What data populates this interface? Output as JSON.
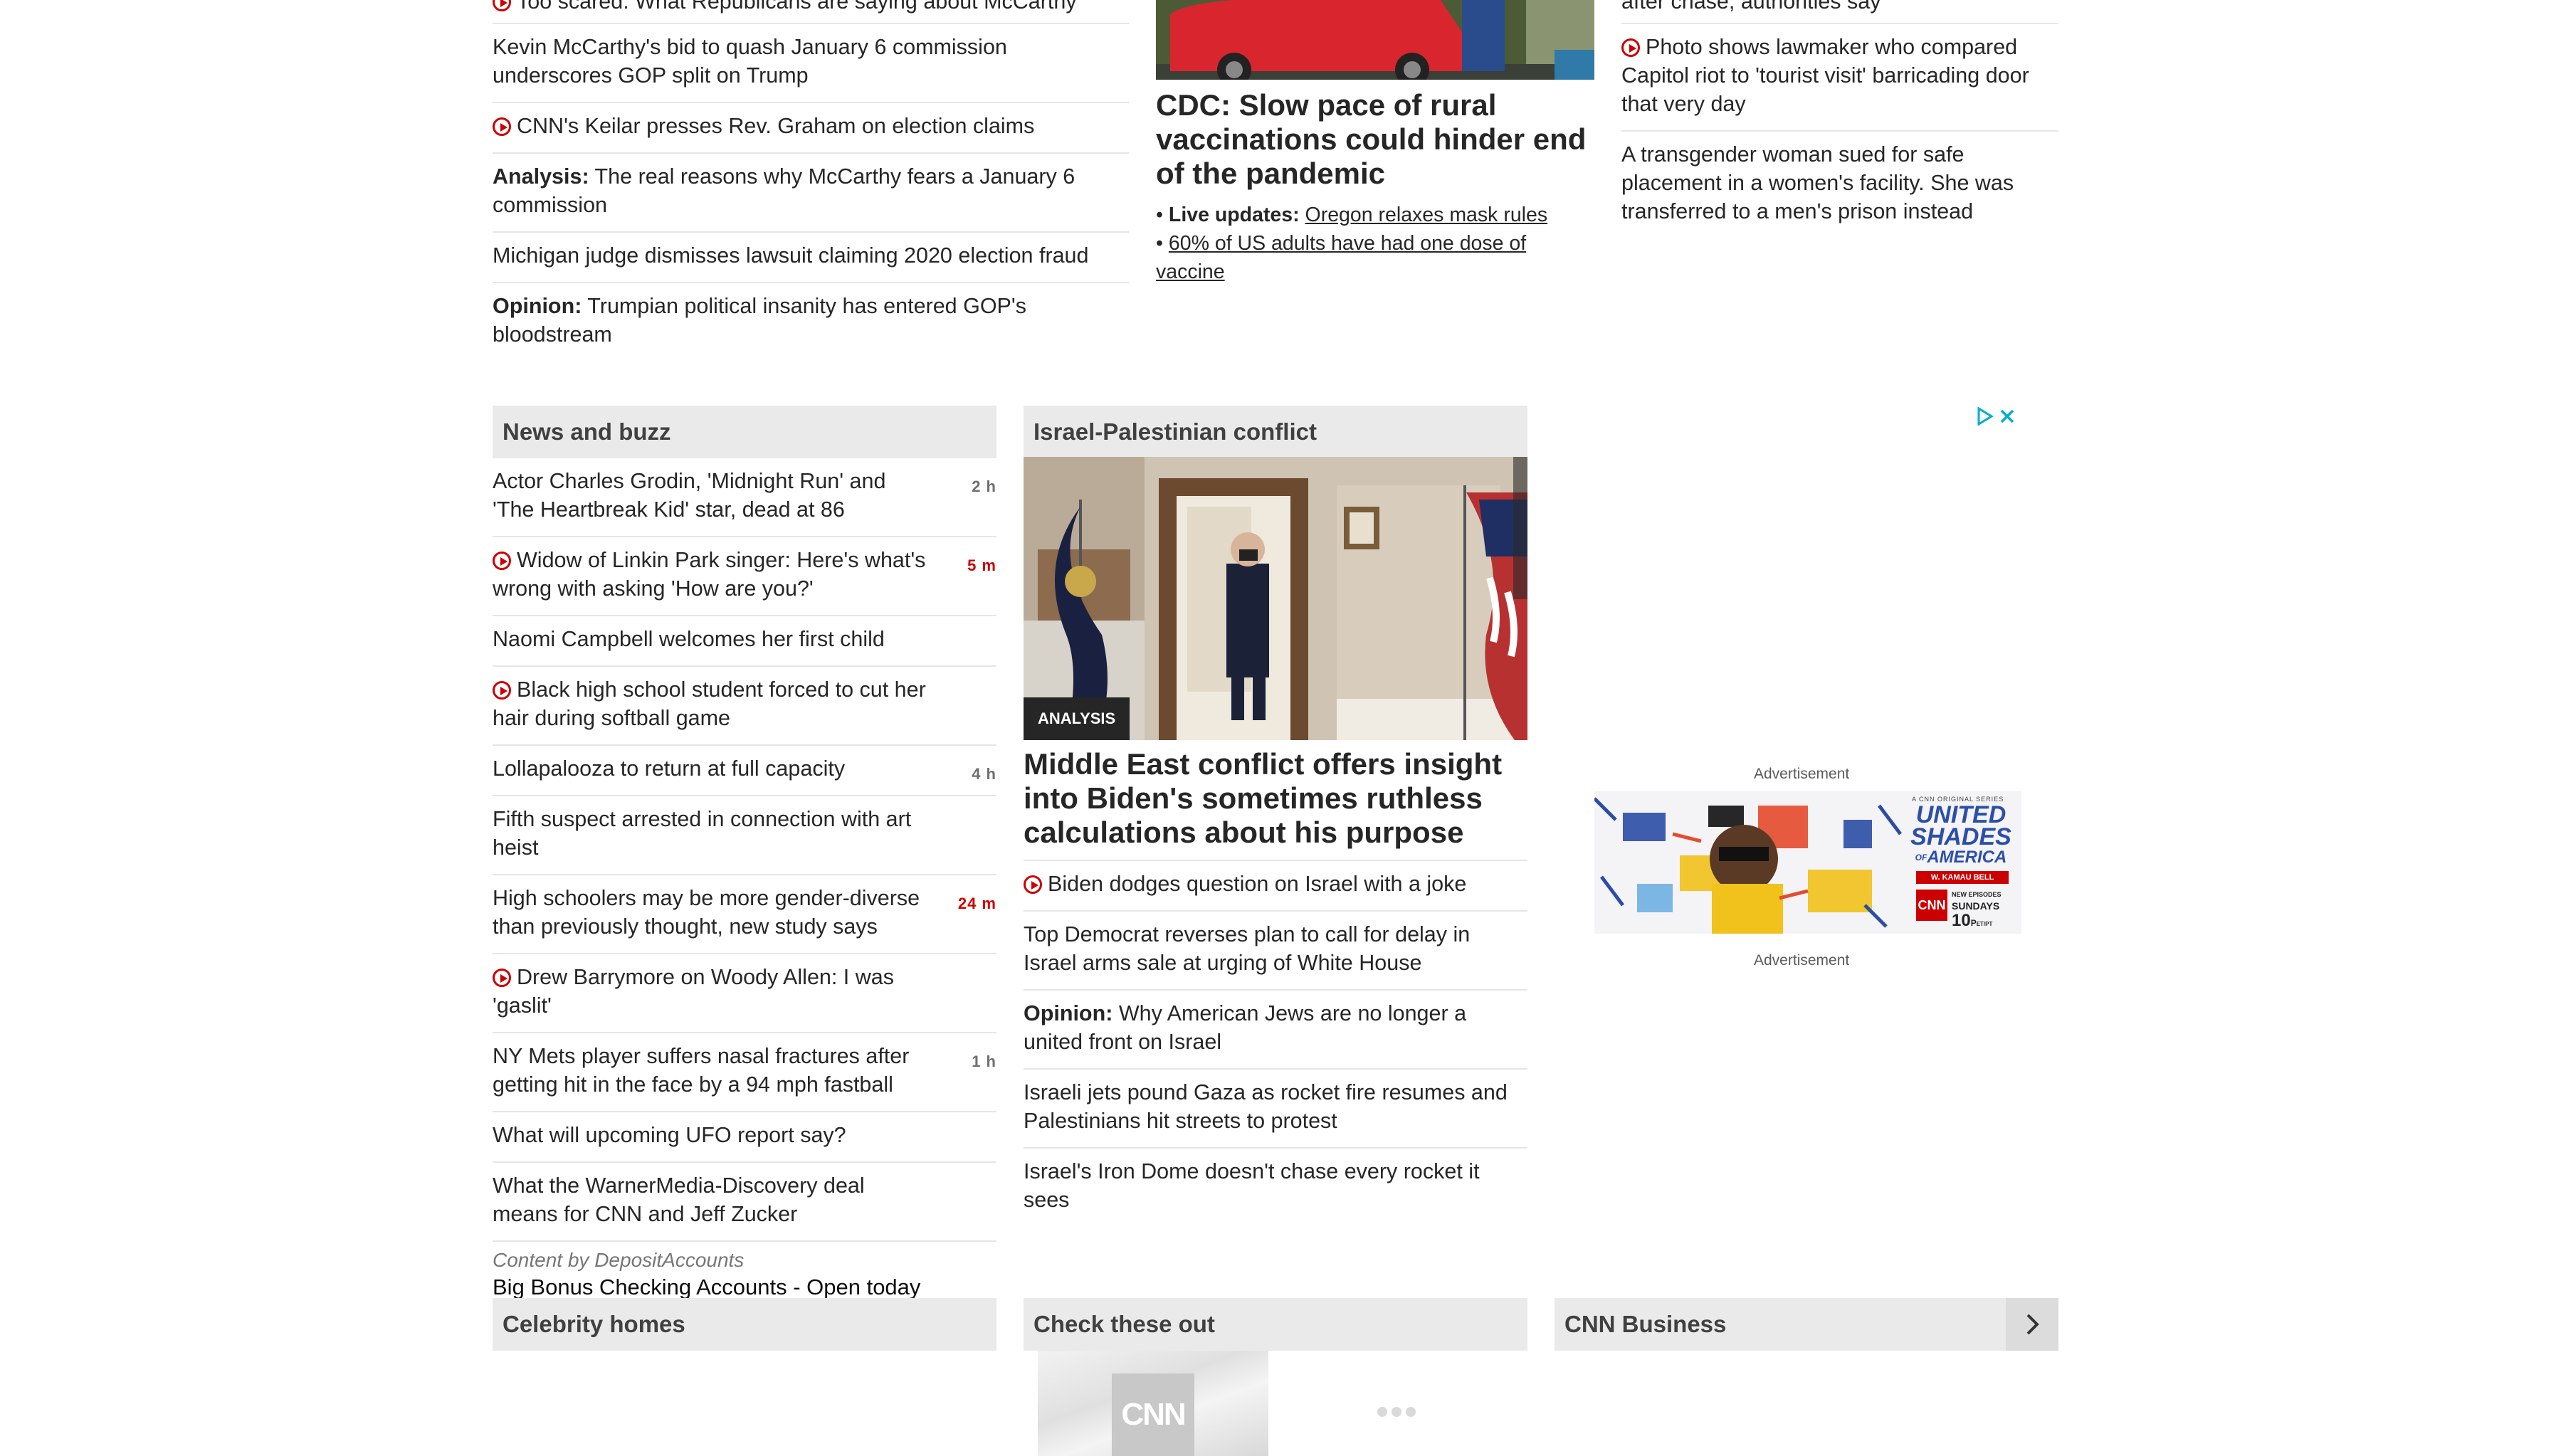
{
  "top_left": {
    "cut_item": "Too scared: What Republicans are saying about McCarthy",
    "items": [
      {
        "prefix": "",
        "text": "Kevin McCarthy's bid to quash January 6 commission underscores GOP split on Trump",
        "video": false
      },
      {
        "prefix": "",
        "text": "CNN's Keilar presses Rev. Graham on election claims",
        "video": true
      },
      {
        "prefix": "Analysis:",
        "text": " The real reasons why McCarthy fears a January 6 commission",
        "video": false
      },
      {
        "prefix": "",
        "text": "Michigan judge dismisses lawsuit claiming 2020 election fraud",
        "video": false
      },
      {
        "prefix": "Opinion:",
        "text": " Trumpian political insanity has entered GOP's bloodstream",
        "video": false
      }
    ]
  },
  "top_middle": {
    "headline": "CDC: Slow pace of rural vaccinations could hinder end of the pandemic",
    "bullet1_prefix": "Live updates:",
    "bullet1_text": "Oregon relaxes mask rules",
    "bullet2_text": "60% of US adults have had one dose of vaccine"
  },
  "top_right": {
    "cut_item": "after chase, authorities say",
    "items": [
      {
        "text": "Photo shows lawmaker who compared Capitol riot to 'tourist visit' barricading door that very day",
        "video": true
      },
      {
        "text": "A transgender woman sued for safe placement in a women's facility. She was transferred to a men's prison instead",
        "video": false
      }
    ]
  },
  "news_buzz": {
    "title": "News and buzz",
    "items": [
      {
        "text": "Actor Charles Grodin, 'Midnight Run' and 'The Heartbreak Kid' star, dead at 86",
        "time": "2 h",
        "red": false,
        "video": false
      },
      {
        "text": "Widow of Linkin Park singer: Here's what's wrong with asking 'How are you?'",
        "time": "5 m",
        "red": true,
        "video": true
      },
      {
        "text": "Naomi Campbell welcomes her first child",
        "time": "",
        "red": false,
        "video": false
      },
      {
        "text": "Black high school student forced to cut her hair during softball game",
        "time": "",
        "red": false,
        "video": true
      },
      {
        "text": "Lollapalooza to return at full capacity",
        "time": "4 h",
        "red": false,
        "video": false
      },
      {
        "text": "Fifth suspect arrested in connection with art heist",
        "time": "",
        "red": false,
        "video": false
      },
      {
        "text": "High schoolers may be more gender-diverse than previously thought, new study says",
        "time": "24 m",
        "red": true,
        "video": false
      },
      {
        "text": "Drew Barrymore on Woody Allen: I was 'gaslit'",
        "time": "",
        "red": false,
        "video": true
      },
      {
        "text": "NY Mets player suffers nasal fractures after getting hit in the face by a 94 mph fastball",
        "time": "1 h",
        "red": false,
        "video": false
      },
      {
        "text": "What will upcoming UFO report say?",
        "time": "",
        "red": false,
        "video": false
      },
      {
        "text": "What the WarnerMedia-Discovery deal means for CNN and Jeff Zucker",
        "time": "",
        "red": false,
        "video": false
      }
    ],
    "sponsor_label": "Content by DepositAccounts",
    "sponsor_link": "Big Bonus Checking Accounts - Open today"
  },
  "israel": {
    "title": "Israel-Palestinian conflict",
    "tag": "ANALYSIS",
    "headline": "Middle East conflict offers insight into Biden's sometimes ruthless calculations about his purpose",
    "items": [
      {
        "prefix": "",
        "text": "Biden dodges question on Israel with a joke",
        "video": true
      },
      {
        "prefix": "",
        "text": "Top Democrat reverses plan to call for delay in Israel arms sale at urging of White House",
        "video": false
      },
      {
        "prefix": "Opinion:",
        "text": " Why American Jews are no longer a united front on Israel",
        "video": false
      },
      {
        "prefix": "",
        "text": "Israeli jets pound Gaza as rocket fire resumes and Palestinians hit streets to protest",
        "video": false
      },
      {
        "prefix": "",
        "text": "Israel's Iron Dome doesn't chase every rocket it sees",
        "video": false
      }
    ]
  },
  "ads": {
    "label_top": "Advertisement",
    "label_bottom": "Advertisement",
    "banner_small": "A CNN ORIGINAL SERIES",
    "banner_title1": "UNITED",
    "banner_title2": "SHADES",
    "banner_title3": "AMERICA",
    "banner_of": "OF",
    "banner_host": "W. KAMAU BELL",
    "banner_cnn": "CNN",
    "banner_new": "NEW EPISODES",
    "banner_day": "SUNDAYS",
    "banner_time": "10",
    "banner_time_sup": "P",
    "banner_zone": "ET/PT"
  },
  "bottom_sections": {
    "celebrity": "Celebrity homes",
    "check": "Check these out",
    "business": "CNN Business",
    "logo": "CNN"
  },
  "colors": {
    "accent_red": "#cc0000",
    "header_gray": "#eaeaea",
    "divider": "#e6e6e6"
  }
}
